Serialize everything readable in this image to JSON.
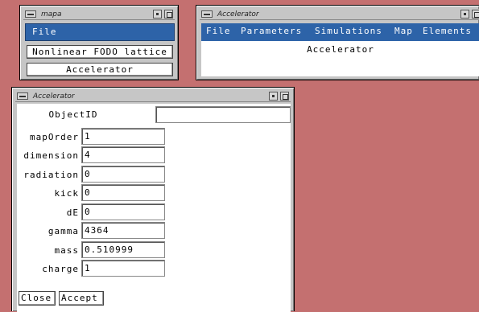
{
  "mapa_window": {
    "title": "mapa",
    "menu_file": "File",
    "lattice_button": "Nonlinear FODO lattice",
    "accelerator_button": "Accelerator"
  },
  "accel_main_window": {
    "title": "Accelerator",
    "menus": [
      "File",
      "Parameters",
      "Simulations",
      "Map",
      "Elements"
    ],
    "content_label": "Accelerator"
  },
  "accel_form_window": {
    "title": "Accelerator",
    "objectid_label": "ObjectID",
    "objectid_value": "",
    "fields": [
      {
        "label": "mapOrder",
        "value": "1"
      },
      {
        "label": "dimension",
        "value": "4"
      },
      {
        "label": "radiation",
        "value": "0"
      },
      {
        "label": "kick",
        "value": "0"
      },
      {
        "label": "dE",
        "value": "0"
      },
      {
        "label": "gamma",
        "value": "4364"
      },
      {
        "label": "mass",
        "value": "0.510999"
      },
      {
        "label": "charge",
        "value": "1"
      }
    ],
    "close_button": "Close",
    "accept_button": "Accept"
  },
  "colors": {
    "desktop": "#c47070",
    "window_frame": "#c6c6c6",
    "menu_blue": "#2d63a8"
  }
}
